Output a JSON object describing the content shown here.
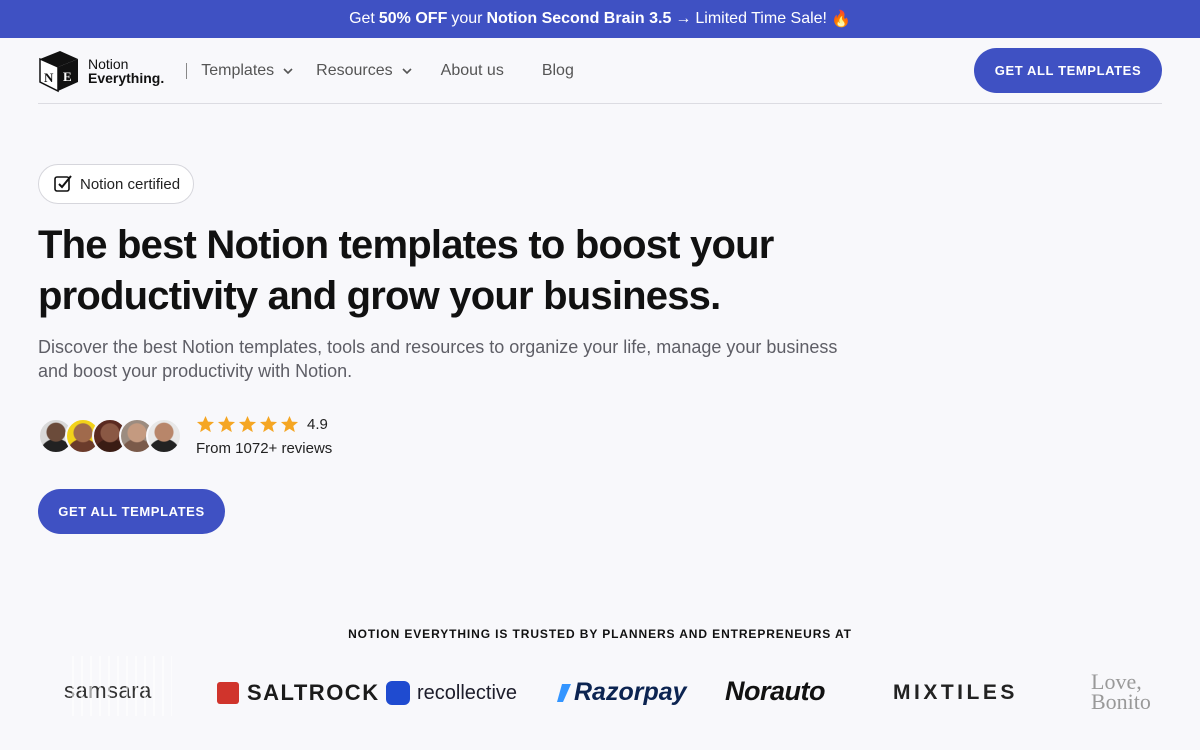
{
  "promo": {
    "prefix": "Get",
    "discount": "50% OFF",
    "middle": "your",
    "product": "Notion Second Brain 3.5",
    "arrow": "→",
    "suffix": "Limited Time Sale!",
    "emoji": "🔥"
  },
  "nav": {
    "logo_line1": "Notion",
    "logo_line2": "Everything.",
    "logo_letters": "N E",
    "items": [
      {
        "label": "Templates",
        "has_dropdown": true
      },
      {
        "label": "Resources",
        "has_dropdown": true
      },
      {
        "label": "About us",
        "has_dropdown": false
      },
      {
        "label": "Blog",
        "has_dropdown": false
      }
    ],
    "cta": "GET ALL TEMPLATES"
  },
  "hero": {
    "badge": "Notion certified",
    "title": "The best Notion templates to boost your productivity and grow your business.",
    "subtitle": "Discover the best Notion templates, tools and resources to organize your life, manage your business and boost your productivity with Notion.",
    "rating": {
      "stars": 5,
      "score": "4.9",
      "reviews": "From 1072+ reviews"
    },
    "cta": "GET ALL TEMPLATES"
  },
  "trusted": {
    "heading": "NOTION EVERYTHING IS TRUSTED BY PLANNERS AND ENTREPRENEURS AT",
    "logos": [
      "samsara",
      "SALTROCK",
      "recollective",
      "Razorpay",
      "Norauto",
      "MIXTILES",
      "Love, Bonito"
    ]
  },
  "colors": {
    "accent": "#3f51c3",
    "star": "#f5a623",
    "background": "#f8f8fb"
  }
}
